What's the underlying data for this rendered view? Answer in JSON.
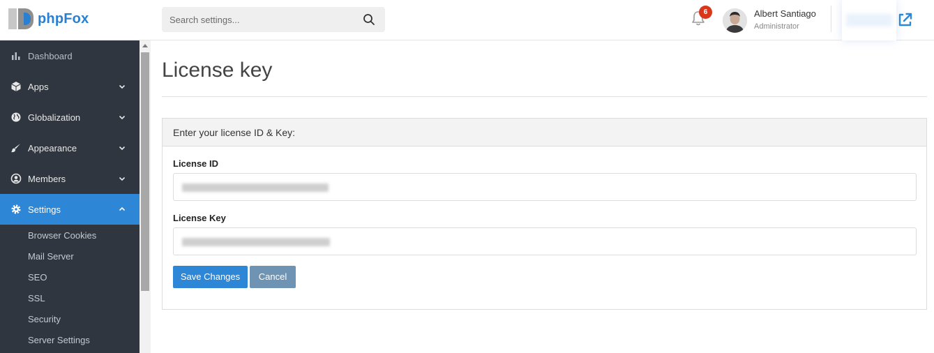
{
  "brand": {
    "name": "phpFox"
  },
  "search": {
    "placeholder": "Search settings..."
  },
  "notifications": {
    "count": "6"
  },
  "user": {
    "name": "Albert Santiago",
    "role": "Administrator"
  },
  "sidebar": {
    "items": [
      {
        "label": "Dashboard",
        "icon": "bar-chart-icon"
      },
      {
        "label": "Apps",
        "icon": "cube-icon"
      },
      {
        "label": "Globalization",
        "icon": "globe-icon"
      },
      {
        "label": "Appearance",
        "icon": "paint-brush-icon"
      },
      {
        "label": "Members",
        "icon": "user-circle-icon"
      },
      {
        "label": "Settings",
        "icon": "gear-icon"
      }
    ],
    "sub_items": [
      "Browser Cookies",
      "Mail Server",
      "SEO",
      "SSL",
      "Security",
      "Server Settings"
    ]
  },
  "main": {
    "title": "License key",
    "panel_heading": "Enter your license ID & Key:",
    "license_id_label": "License ID",
    "license_key_label": "License Key",
    "save_label": "Save Changes",
    "cancel_label": "Cancel"
  },
  "colors": {
    "accent": "#2e86d6",
    "sidebar_bg": "#2f3640",
    "badge": "#d9371b",
    "cancel": "#6f93b2"
  }
}
